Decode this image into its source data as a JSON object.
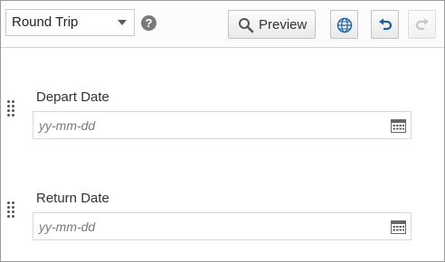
{
  "toolbar": {
    "trip_type": {
      "value": "Round Trip",
      "caret_icon": "chevron-down-icon"
    },
    "help_glyph": "?",
    "preview_label": "Preview",
    "icons": [
      "search-icon",
      "globe-icon",
      "undo-icon",
      "redo-icon"
    ]
  },
  "fields": [
    {
      "label": "Depart Date",
      "placeholder": "yy-mm-dd",
      "icon": "calendar-icon"
    },
    {
      "label": "Return Date",
      "placeholder": "yy-mm-dd",
      "icon": "calendar-icon"
    }
  ],
  "colors": {
    "accent": "#1a5fa6",
    "muted_icon": "#7a7a7a"
  }
}
